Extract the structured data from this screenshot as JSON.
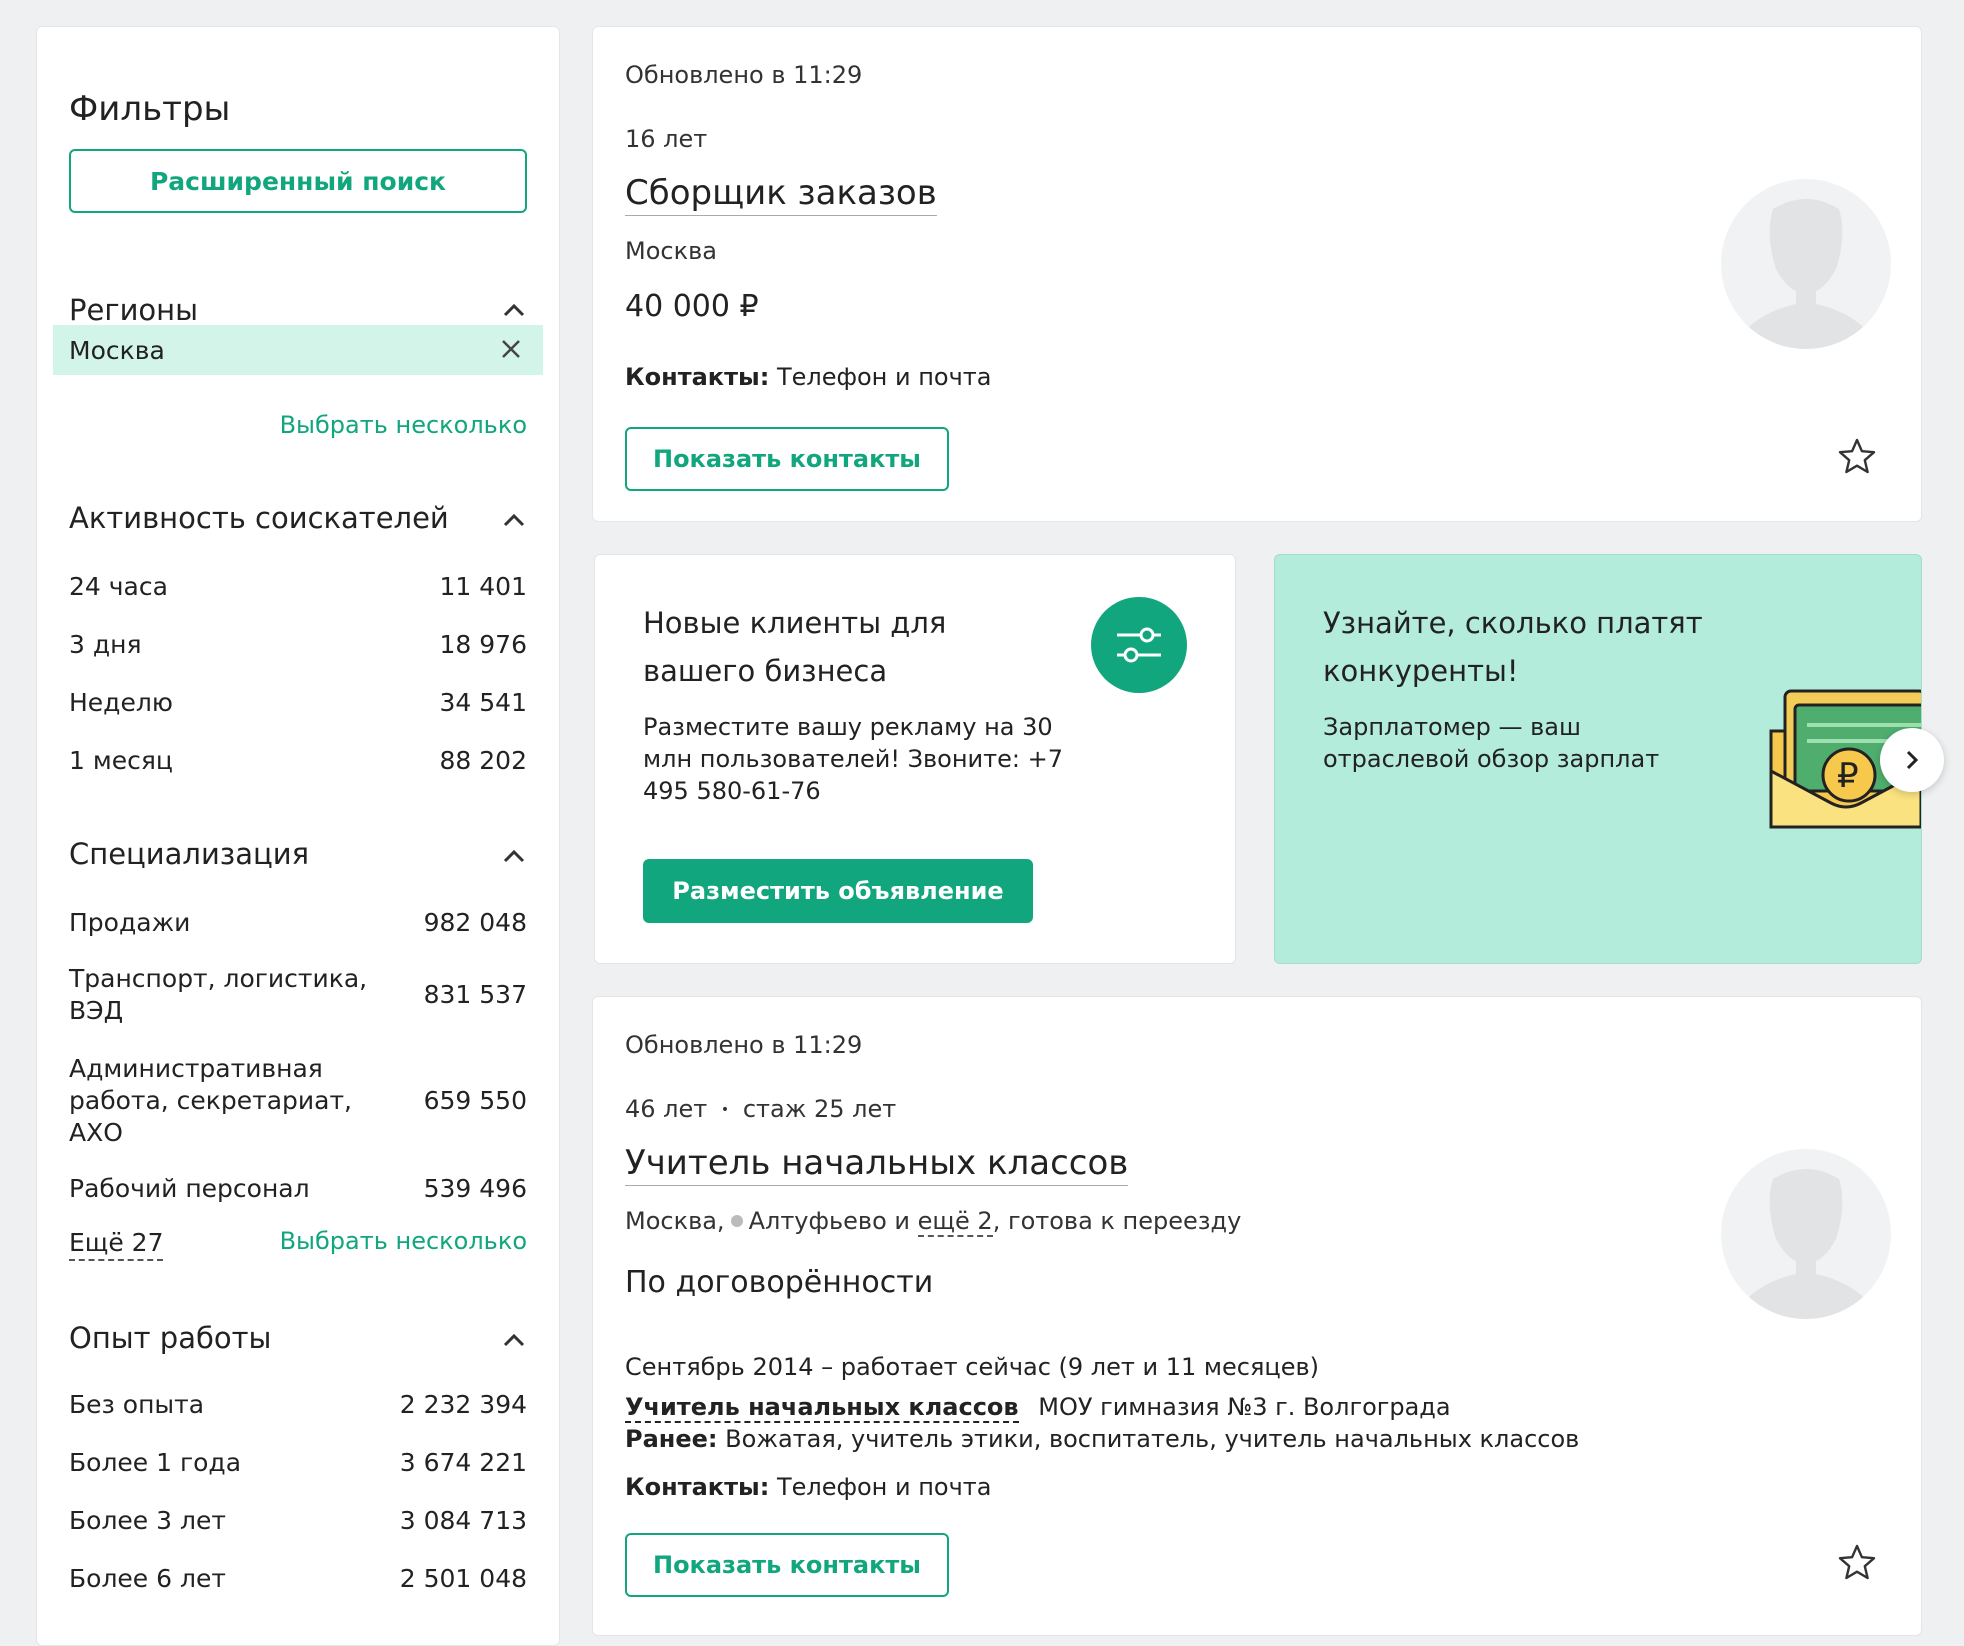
{
  "sidebar": {
    "title": "Фильтры",
    "advanced_search": "Расширенный поиск",
    "regions": {
      "heading": "Регионы",
      "selected": "Москва",
      "choose_many": "Выбрать несколько"
    },
    "activity": {
      "heading": "Активность соискателей",
      "items": [
        {
          "label": "24 часа",
          "count": "11 401"
        },
        {
          "label": "3 дня",
          "count": "18 976"
        },
        {
          "label": "Неделю",
          "count": "34 541"
        },
        {
          "label": "1 месяц",
          "count": "88 202"
        }
      ]
    },
    "specialization": {
      "heading": "Специализация",
      "items": [
        {
          "label": "Продажи",
          "count": "982 048"
        },
        {
          "label": "Транспорт, логистика, ВЭД",
          "count": "831 537"
        },
        {
          "label": "Административная работа, секретариат, АХО",
          "count": "659 550"
        },
        {
          "label": "Рабочий персонал",
          "count": "539 496"
        }
      ],
      "more": "Ещё 27",
      "choose_many": "Выбрать несколько"
    },
    "experience": {
      "heading": "Опыт работы",
      "items": [
        {
          "label": "Без опыта",
          "count": "2 232 394"
        },
        {
          "label": "Более 1 года",
          "count": "3 674 221"
        },
        {
          "label": "Более 3 лет",
          "count": "3 084 713"
        },
        {
          "label": "Более 6 лет",
          "count": "2 501 048"
        }
      ]
    }
  },
  "resume1": {
    "updated": "Обновлено в 11:29",
    "age": "16 лет",
    "title": "Сборщик заказов",
    "city": "Москва",
    "salary": "40 000 ₽",
    "contacts_label": "Контакты:",
    "contacts_value": "Телефон и почта",
    "show_contacts": "Показать контакты",
    "avatar_icon": "user-silhouette-icon",
    "favorite_icon": "star-icon"
  },
  "ad": {
    "title": "Новые клиенты для вашего бизнеса",
    "text": "Разместите вашу рекламу на 30 млн пользователей! Звоните: +7 495 580-61-76",
    "button": "Разместить объявление",
    "icon": "sliders-icon"
  },
  "promo": {
    "title": "Узнайте, сколько платят конкуренты!",
    "text": "Зарплатомер — ваш отраслевой обзор зарплат",
    "image": "money-envelope-illustration",
    "next_icon": "chevron-right-icon"
  },
  "resume2": {
    "updated": "Обновлено в 11:29",
    "age": "46 лет",
    "separator": "•",
    "experience": "стаж 25 лет",
    "title": "Учитель начальных классов",
    "city": "Москва,",
    "metro": "Алтуфьево",
    "and": "и",
    "more": "ещё 2",
    "relocation": ", готова к переезду",
    "salary": "По договорённости",
    "period": "Сентябрь 2014 – работает сейчас",
    "duration": "(9 лет и 11 месяцев)",
    "role": "Учитель начальных классов",
    "employer": "МОУ гимназия №3 г. Волгограда",
    "earlier_label": "Ранее:",
    "earlier_value": "Вожатая, учитель этики, воспитатель, учитель начальных классов",
    "contacts_label": "Контакты:",
    "contacts_value": "Телефон и почта",
    "show_contacts": "Показать контакты"
  },
  "colors": {
    "accent": "#11a67d",
    "chip_bg": "#d3f5e9",
    "promo_bg": "#b4ecdb",
    "page_bg": "#eef0f1"
  }
}
